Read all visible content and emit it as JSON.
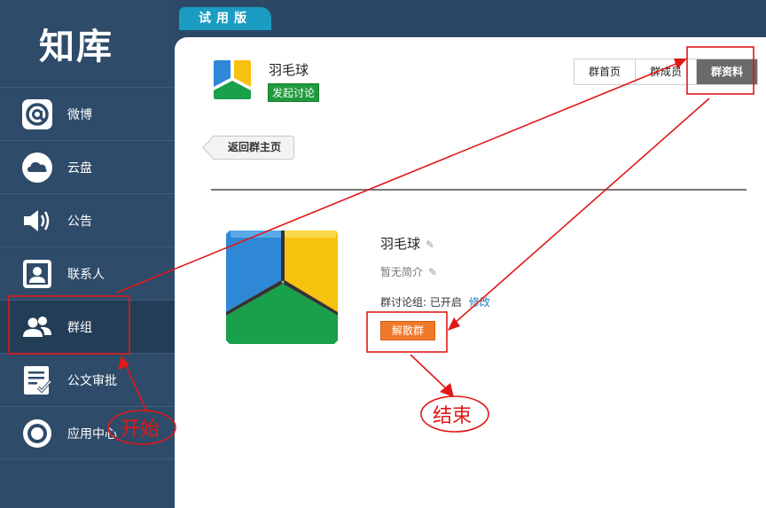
{
  "sidebar": {
    "logo": "知库",
    "items": [
      {
        "label": "微博",
        "icon": "at-icon"
      },
      {
        "label": "云盘",
        "icon": "cloud-icon"
      },
      {
        "label": "公告",
        "icon": "speaker-icon"
      },
      {
        "label": "联系人",
        "icon": "contact-icon"
      },
      {
        "label": "群组",
        "icon": "group-icon",
        "active": true
      },
      {
        "label": "公文审批",
        "icon": "document-check-icon"
      },
      {
        "label": "应用中心",
        "icon": "app-center-icon"
      }
    ]
  },
  "trial_tab": "试用版",
  "header": {
    "group_name": "羽毛球",
    "discuss_button": "发起讨论",
    "tabs": [
      "群首页",
      "群成员",
      "群资料"
    ],
    "active_tab": "群资料"
  },
  "back_button": "返回群主页",
  "profile": {
    "group_name": "羽毛球",
    "intro": "暂无简介",
    "discuss_status": "群讨论组: 已开启",
    "edit_link": "修改",
    "dissolve_button": "解散群"
  },
  "annotations": {
    "start": "开始",
    "end": "结束",
    "color": "#e01818"
  },
  "colors": {
    "sidebar": "#2e4b69",
    "trial_tab": "#1b9cc2",
    "discuss_button": "#1f9a3c",
    "dissolve_button": "#f07a2b",
    "active_tab": "#6a6a6a"
  }
}
